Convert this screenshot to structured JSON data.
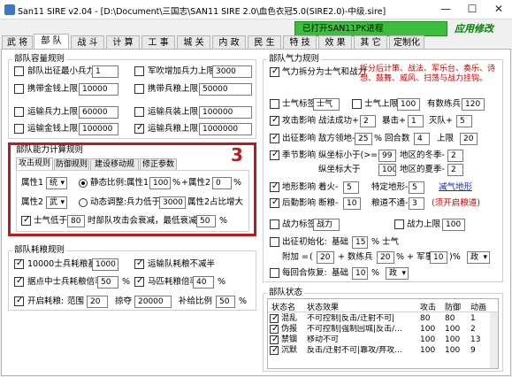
{
  "window": {
    "title": "San11 SIRE v2.04 - [D:\\Document\\三国志\\SAN11 SIRE 2.0\\血色衣冠5.0(SIRE2.0)-中级.sire]",
    "min": "—",
    "max": "☐",
    "close": "✕"
  },
  "header": {
    "launch": "已打开SAN11PK进程",
    "apply": "应用修改"
  },
  "tabs": [
    "武 将",
    "部 队",
    "战 斗",
    "计 算",
    "工 事",
    "城 关",
    "内 政",
    "民 生",
    "特 技",
    "效 果",
    "其 它",
    "定制化"
  ],
  "colors": {
    "accent_green": "#3dbd3d",
    "highlight_red": "#c0191d",
    "note_red": "#d00000",
    "link_blue": "#1030d0"
  },
  "capacity": {
    "title": "部队容量规则",
    "r1a": {
      "label": "部队出征最小兵力",
      "value": "1",
      "checked": false
    },
    "r1b": {
      "label": "军吹增加兵力上限",
      "value": "3000",
      "checked": false
    },
    "r2a": {
      "label": "携带金钱上限",
      "value": "10000",
      "checked": false
    },
    "r2b": {
      "label": "携带兵粮上限",
      "value": "50000",
      "checked": false
    },
    "r3a": {
      "label": "运输兵力上限",
      "value": "60000",
      "checked": false
    },
    "r3b": {
      "label": "运输兵装上限",
      "value": "100000",
      "checked": false
    },
    "r4a": {
      "label": "运输金钱上限",
      "value": "100000",
      "checked": false
    },
    "r4b": {
      "label": "运输兵粮上限",
      "value": "1000000",
      "checked": true
    }
  },
  "ability": {
    "title": "部队能力计算规则",
    "badge": "3",
    "subtabs": [
      "攻击规则",
      "防御规则",
      "建设移动规则",
      "修正参数"
    ],
    "attr1_label": "属性1",
    "attr1_value": "统",
    "attr2_label": "属性2",
    "attr2_value": "武",
    "static_label": "静态比例:",
    "static_attr1": "属性1",
    "static_val1": "100",
    "pct": "%",
    "plus": "+",
    "static_attr2": "属性2",
    "static_val2": "0",
    "dynamic_label": "动态调整:",
    "dynamic_text1": "兵力低于",
    "dynamic_val": "3000",
    "dynamic_text2": "属性2占比增大",
    "morale_label": "士气低于",
    "morale_val": "80",
    "morale_text": "时部队攻击会衰减，最低衰减比例",
    "morale_pct": "50"
  },
  "food": {
    "title": "部队耗粮规则",
    "r1a": {
      "label": "10000士兵耗粮基数",
      "value": "1000",
      "checked": true
    },
    "r1b": {
      "label": "运输队耗粮不减半",
      "checked": true
    },
    "r2a": {
      "label": "据点中士兵耗粮倍率",
      "value": "50",
      "checked": true
    },
    "r2b": {
      "label": "马匹耗粮倍率",
      "value": "40",
      "checked": true
    },
    "r3": {
      "label": "开启耗粮:",
      "range_label": "范围",
      "range": "20",
      "deduct_label": "掠夺",
      "deduct": "20000",
      "ratio_label": "补给比例",
      "ratio": "50",
      "checked": true
    }
  },
  "morale": {
    "title": "部队气力规则",
    "split": {
      "label": "气力拆分为士气和战力",
      "note": "拆分后计策、战法、军乐台、奏乐、诗\n想、鼓舞、威风、扫荡与战力挂钩。",
      "checked": true
    },
    "tag1": {
      "label": "士气标签",
      "value": "士气"
    },
    "cap1": {
      "label": "士气上限",
      "value": "100"
    },
    "unit_label": "有数练兵",
    "unit_value": "120",
    "atk": {
      "label": "攻击影响",
      "text1": "战法成功+",
      "v1": "2",
      "text2": "暴击+",
      "v2": "1",
      "text3": "灭队+",
      "v3": "5",
      "checked": true
    },
    "dep": {
      "label": "出征影响",
      "text1": "敌方领地-",
      "v1": "25",
      "text2": "回合数",
      "v2": "4",
      "text3": "上限",
      "v3": "20",
      "checked": true
    },
    "season": {
      "label": "季节影响",
      "r1t1": "纵坐标小于(>=)",
      "r1v1": "99",
      "r1t2": "地区的冬季-",
      "r1v2": "2",
      "r2t1": "纵坐标大于",
      "r2v1": "100",
      "r2t2": "地区的夏季-",
      "r2v2": "2",
      "checked": true
    },
    "terrain": {
      "label": "地形影响",
      "text1": "着火-",
      "v1": "5",
      "text2": "特定地形-",
      "v2": "5",
      "link": "减气地形",
      "checked": true
    },
    "rest": {
      "label": "后勤影响",
      "text1": "断粮-",
      "v1": "10",
      "text2": "粮道不通-",
      "v2": "3",
      "note": "(须开启粮道)",
      "checked": true
    },
    "tag2": {
      "label": "战力标签",
      "value": "战力",
      "checked": false
    },
    "cap2": {
      "label": "战力上限",
      "value": "100",
      "checked": false
    },
    "init": {
      "label": "出征初始化:",
      "base_label": "基础",
      "base": "15",
      "pct": "%",
      "stat_label": "士气",
      "checked": false
    },
    "addon": {
      "label": "附加 =",
      "open": "(",
      "v1": "20",
      "t1": "+ 数练兵",
      "v2": "20",
      "t2": "% + 军事府",
      "v3": "10",
      "t3": ")%",
      "sel": "政"
    },
    "daily": {
      "label": "每回合恢复:",
      "base_label": "基础",
      "base": "10",
      "pct": "%",
      "sel": "政",
      "checked": false
    }
  },
  "status": {
    "title": "部队状态",
    "headers": [
      "状态名",
      "状态效果",
      "攻击",
      "防御",
      "动画"
    ],
    "rows": [
      {
        "name": "混乱",
        "effect": "不可控制|反击/迁射不可|",
        "atk": "80",
        "def": "80",
        "anim": "1",
        "checked": true
      },
      {
        "name": "伪报",
        "effect": "不可控制|强制回城|反击/...",
        "atk": "100",
        "def": "100",
        "anim": "2",
        "checked": true
      },
      {
        "name": "禁锢",
        "effect": "移动不可",
        "atk": "100",
        "def": "100",
        "anim": "13",
        "checked": true
      },
      {
        "name": "沉默",
        "effect": "反击/迁射不可|靠攻/弃攻...",
        "atk": "100",
        "def": "100",
        "anim": "9",
        "checked": true
      }
    ]
  }
}
